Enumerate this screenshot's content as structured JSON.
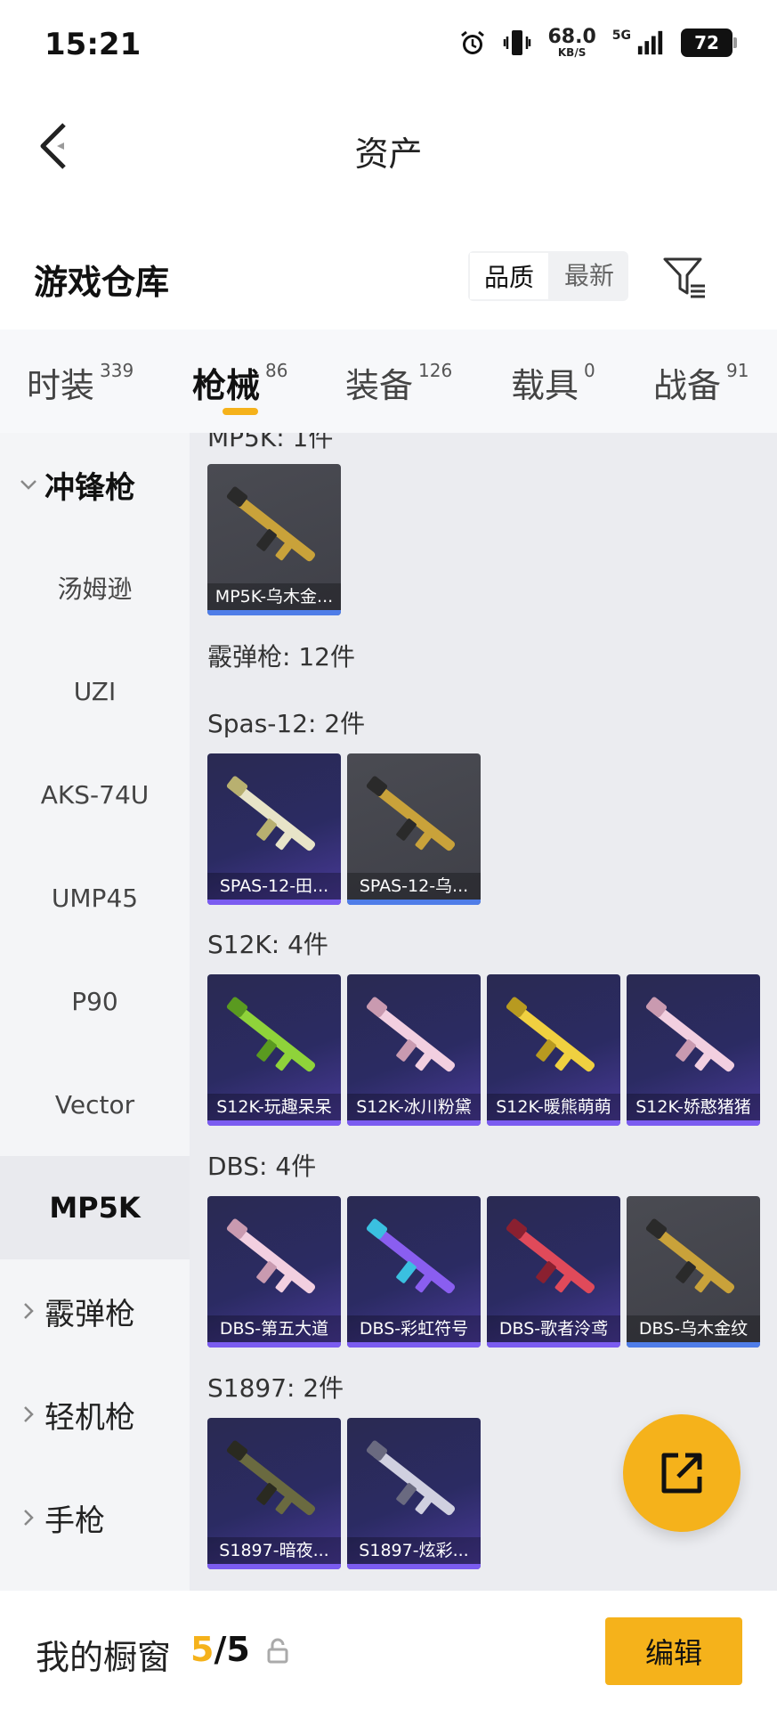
{
  "status": {
    "time": "15:21",
    "net_speed": "68.0",
    "net_unit": "KB/S",
    "signal_label": "5G",
    "battery": "72"
  },
  "nav": {
    "title": "资产"
  },
  "warehouse": {
    "title": "游戏仓库",
    "sort_options": [
      "品质",
      "最新"
    ]
  },
  "tabs": [
    {
      "label": "时装",
      "count": "339"
    },
    {
      "label": "枪械",
      "count": "86"
    },
    {
      "label": "装备",
      "count": "126"
    },
    {
      "label": "载具",
      "count": "0"
    },
    {
      "label": "战备",
      "count": "91"
    }
  ],
  "sidebar": {
    "category_open": "冲锋枪",
    "items": [
      "汤姆逊",
      "UZI",
      "AKS-74U",
      "UMP45",
      "P90",
      "Vector",
      "MP5K"
    ],
    "categories": [
      "霰弹枪",
      "轻机枪",
      "手枪"
    ]
  },
  "content": {
    "partial_header": "MP5K: 1件",
    "mp5k_items": [
      {
        "name": "MP5K-乌木金...",
        "color": "gold"
      }
    ],
    "shotgun_total": "霰弹枪: 12件",
    "groups": [
      {
        "label": "Spas-12: 2件",
        "items": [
          {
            "name": "SPAS-12-田...",
            "color": "cream"
          },
          {
            "name": "SPAS-12-乌...",
            "color": "gold"
          }
        ]
      },
      {
        "label": "S12K: 4件",
        "items": [
          {
            "name": "S12K-玩趣呆呆",
            "color": "green"
          },
          {
            "name": "S12K-冰川粉黛",
            "color": "pink"
          },
          {
            "name": "S12K-暖熊萌萌",
            "color": "yellow"
          },
          {
            "name": "S12K-娇憨猪猪",
            "color": "pink"
          }
        ]
      },
      {
        "label": "DBS: 4件",
        "items": [
          {
            "name": "DBS-第五大道",
            "color": "pink"
          },
          {
            "name": "DBS-彩虹符号",
            "color": "rainbow"
          },
          {
            "name": "DBS-歌者泠鸢",
            "color": "red"
          },
          {
            "name": "DBS-乌木金纹",
            "color": "gold"
          }
        ]
      },
      {
        "label": "S1897: 2件",
        "items": [
          {
            "name": "S1897-暗夜...",
            "color": "olive"
          },
          {
            "name": "S1897-炫彩...",
            "color": "silver"
          }
        ]
      }
    ]
  },
  "bottom": {
    "label": "我的橱窗",
    "count_current": "5",
    "count_total": "/5",
    "edit_label": "编辑"
  },
  "colors": {
    "accent": "#f5b21b",
    "purple_bg": "#2b2b63",
    "gray_bg": "#45464d"
  }
}
